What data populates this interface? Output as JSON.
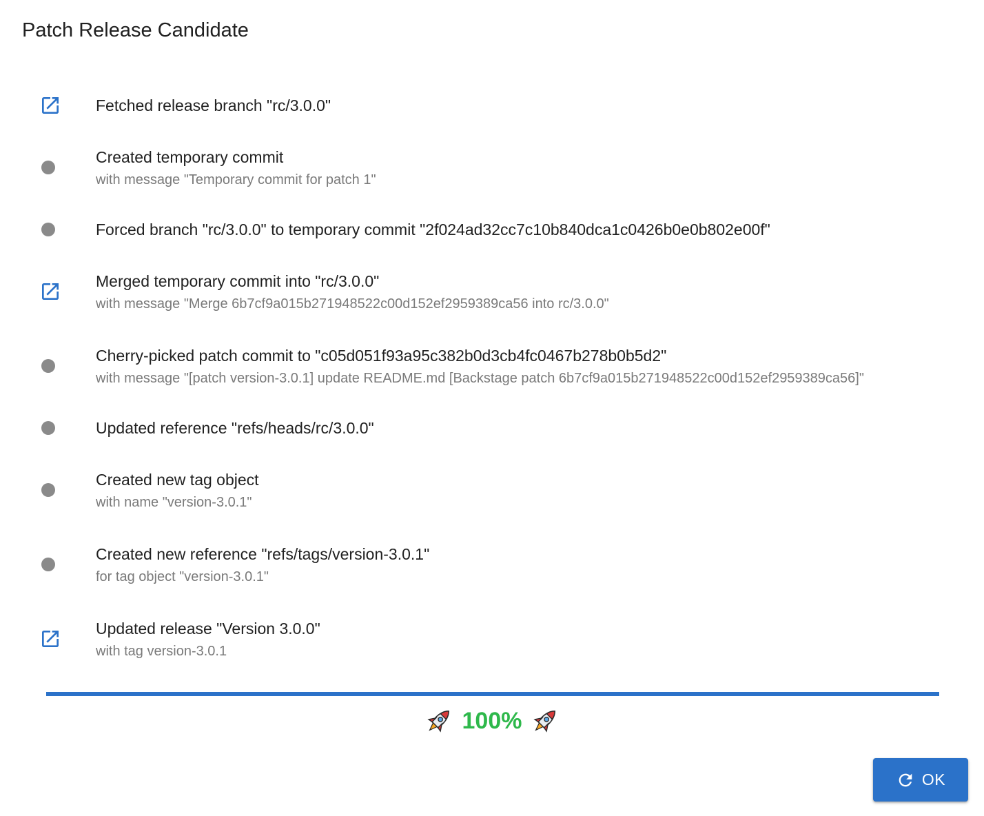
{
  "dialog": {
    "title": "Patch Release Candidate"
  },
  "steps": [
    {
      "icon": "open-in-new-icon",
      "message": "Fetched release branch \"rc/3.0.0\"",
      "secondary": ""
    },
    {
      "icon": "dot-icon",
      "message": "Created temporary commit",
      "secondary": "with message \"Temporary commit for patch 1\""
    },
    {
      "icon": "dot-icon",
      "message": "Forced branch \"rc/3.0.0\" to temporary commit \"2f024ad32cc7c10b840dca1c0426b0e0b802e00f\"",
      "secondary": ""
    },
    {
      "icon": "open-in-new-icon",
      "message": "Merged temporary commit into \"rc/3.0.0\"",
      "secondary": "with message \"Merge 6b7cf9a015b271948522c00d152ef2959389ca56 into rc/3.0.0\""
    },
    {
      "icon": "dot-icon",
      "message": "Cherry-picked patch commit to \"c05d051f93a95c382b0d3cb4fc0467b278b0b5d2\"",
      "secondary": "with message \"[patch version-3.0.1] update README.md [Backstage patch 6b7cf9a015b271948522c00d152ef2959389ca56]\""
    },
    {
      "icon": "dot-icon",
      "message": "Updated reference \"refs/heads/rc/3.0.0\"",
      "secondary": ""
    },
    {
      "icon": "dot-icon",
      "message": "Created new tag object",
      "secondary": "with name \"version-3.0.1\""
    },
    {
      "icon": "dot-icon",
      "message": "Created new reference \"refs/tags/version-3.0.1\"",
      "secondary": "for tag object \"version-3.0.1\""
    },
    {
      "icon": "open-in-new-icon",
      "message": "Updated release \"Version 3.0.0\"",
      "secondary": "with tag version-3.0.1"
    }
  ],
  "progress": {
    "value": 1.0,
    "label": "100%",
    "icon": "rocket-icon"
  },
  "actions": {
    "ok_label": "OK",
    "ok_icon": "refresh-icon"
  },
  "colors": {
    "primary": "#2b72c9",
    "success": "#2eb84b",
    "dot": "#8a8a8a",
    "secondary_text": "#7a7a7a"
  }
}
